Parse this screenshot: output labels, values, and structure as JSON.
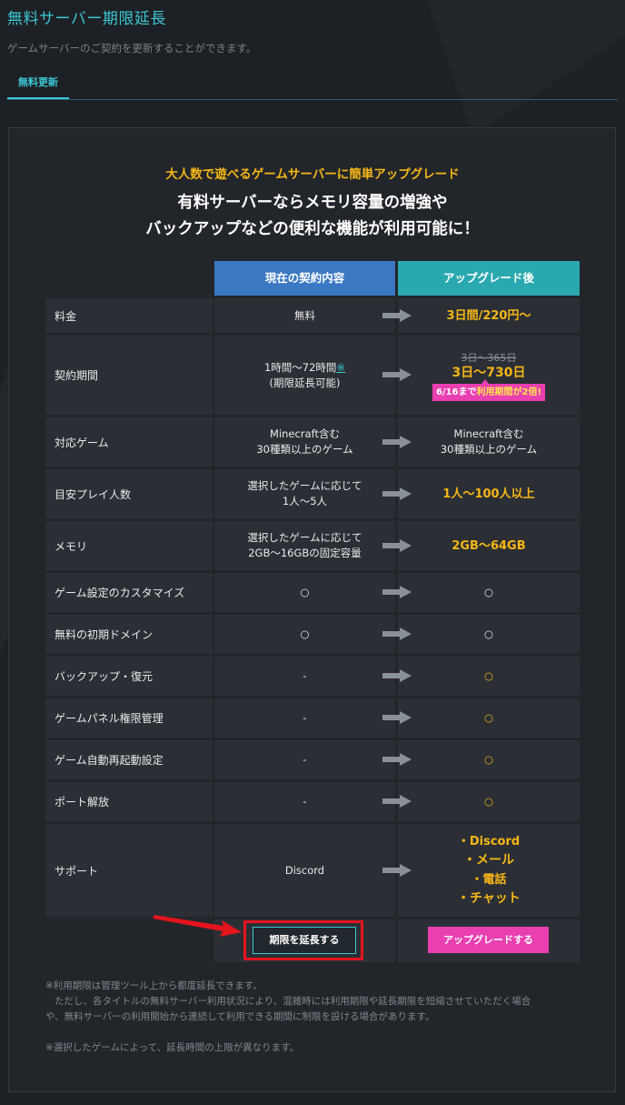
{
  "page": {
    "title": "無料サーバー期限延長",
    "description": "ゲームサーバーのご契約を更新することができます。"
  },
  "tabs": [
    {
      "label": "無料更新",
      "active": true
    }
  ],
  "promo": {
    "tagline": "大人数で遊べるゲームサーバーに簡単アップグレード",
    "headline_1": "有料サーバーならメモリ容量の増強や",
    "headline_2": "バックアップなどの便利な機能が利用可能に！"
  },
  "table": {
    "header_current": "現在の契約内容",
    "header_upgrade": "アップグレード後",
    "rows": [
      {
        "label": "料金",
        "current": "無料",
        "upgrade": "3日間/220円〜"
      },
      {
        "label": "契約期間",
        "current_1": "1時間〜72時間",
        "current_note_mark": "※",
        "current_2": "(期限延長可能)",
        "upgrade_old": "3日〜365日",
        "upgrade": "3日〜730日",
        "badge_prefix": "6/16まで",
        "badge_highlight": "利用期間が2倍!"
      },
      {
        "label": "対応ゲーム",
        "current_1": "Minecraft含む",
        "current_2": "30種類以上のゲーム",
        "upgrade_1": "Minecraft含む",
        "upgrade_2": "30種類以上のゲーム"
      },
      {
        "label": "目安プレイ人数",
        "current_1": "選択したゲームに応じて",
        "current_2": "1人〜5人",
        "upgrade": "1人〜100人以上"
      },
      {
        "label": "メモリ",
        "current_1": "選択したゲームに応じて",
        "current_2": "2GB〜16GBの固定容量",
        "upgrade": "2GB〜64GB"
      },
      {
        "label": "ゲーム設定のカスタマイズ",
        "current": "○",
        "upgrade": "○"
      },
      {
        "label": "無料の初期ドメイン",
        "current": "○",
        "upgrade": "○"
      },
      {
        "label": "バックアップ・復元",
        "current": "-",
        "upgrade": "○"
      },
      {
        "label": "ゲームパネル権限管理",
        "current": "-",
        "upgrade": "○"
      },
      {
        "label": "ゲーム自動再起動設定",
        "current": "-",
        "upgrade": "○"
      },
      {
        "label": "ポート解放",
        "current": "-",
        "upgrade": "○"
      },
      {
        "label": "サポート",
        "current": "Discord",
        "upgrade_list": [
          "・Discord",
          "・メール",
          "・電話",
          "・チャット"
        ]
      }
    ]
  },
  "buttons": {
    "extend": "期限を延長する",
    "upgrade": "アップグレードする"
  },
  "notes": {
    "line_1": "※利用期限は管理ツール上から都度延長できます。",
    "line_2": "ただし、各タイトルの無料サーバー利用状況により、混雑時には利用期限や延長期限を短縮させていただく場合",
    "line_3": "や、無料サーバーの利用開始から連続して利用できる期間に制限を設ける場合があります。",
    "line_4": "※選択したゲームによって、延長時間の上限が異なります。"
  },
  "colors": {
    "accent_teal": "#3cc8d4",
    "header_blue": "#3a78c3",
    "header_teal": "#2aa8b0",
    "gold": "#f5b617",
    "pink": "#e93fb0",
    "highlight_red": "#e4141d"
  },
  "icons": {
    "row_arrow": "arrow-right-icon",
    "callout_arrow": "red-pointer-arrow-icon"
  }
}
